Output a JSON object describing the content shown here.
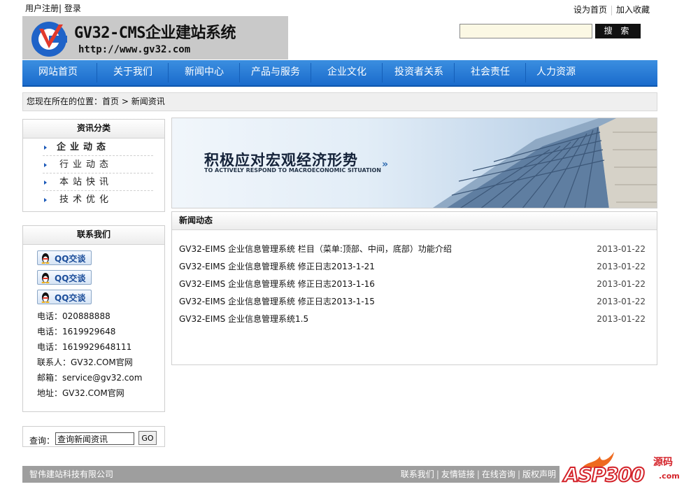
{
  "topbar": {
    "register": "用户注册",
    "login": "登录",
    "set_home": "设为首页",
    "add_favorite": "加入收藏"
  },
  "logo": {
    "title": "GV32-CMS企业建站系统",
    "url": "http://www.gv32.com"
  },
  "search": {
    "value": "",
    "button": "搜 索"
  },
  "nav": {
    "items": [
      "网站首页",
      "关于我们",
      "新闻中心",
      "产品与服务",
      "企业文化",
      "投资者关系",
      "社会责任",
      "人力资源"
    ]
  },
  "breadcrumb": {
    "prefix": "您现在所在的位置：",
    "home": "首页",
    "separator": " > ",
    "current": "新闻资讯"
  },
  "categories": {
    "title": "资讯分类",
    "items": [
      "企业动态",
      "行业动态",
      "本站快讯",
      "技术优化"
    ]
  },
  "contact": {
    "title": "联系我们",
    "qq_label": "QQ交谈",
    "lines": [
      "电话：020888888",
      "电话：1619929648",
      "电话：1619929648111",
      "联系人：GV32.COM官网",
      "邮箱：service@gv32.com",
      "地址：GV32.COM官网"
    ]
  },
  "query": {
    "label": "查询：",
    "value": "查询新闻资讯",
    "button": "GO"
  },
  "banner": {
    "title": "积极应对宏观经济形势",
    "subtitle": "TO ACTIVELY RESPOND TO MACROECONOMIC SITUATION"
  },
  "news": {
    "title": "新闻动态",
    "items": [
      {
        "title": "GV32-EIMS 企业信息管理系统 栏目（菜单:顶部、中间，底部）功能介绍",
        "date": "2013-01-22"
      },
      {
        "title": "GV32-EIMS 企业信息管理系统 修正日志2013-1-21",
        "date": "2013-01-22"
      },
      {
        "title": "GV32-EIMS 企业信息管理系统 修正日志2013-1-16",
        "date": "2013-01-22"
      },
      {
        "title": "GV32-EIMS 企业信息管理系统 修正日志2013-1-15",
        "date": "2013-01-22"
      },
      {
        "title": "GV32-EIMS 企业信息管理系统1.5",
        "date": "2013-01-22"
      }
    ]
  },
  "footer": {
    "company": "智伟建站科技有限公司",
    "links": [
      "联系我们",
      "友情链接",
      "在线咨询",
      "版权声明"
    ]
  },
  "watermark": {
    "brand": "ASP300",
    "cn": "源码",
    "domain": ".com"
  },
  "colors": {
    "nav_blue": "#1a6bcc",
    "search_button": "#111111",
    "footer_gray": "#9e9e9e",
    "watermark_red": "#d4232a"
  }
}
